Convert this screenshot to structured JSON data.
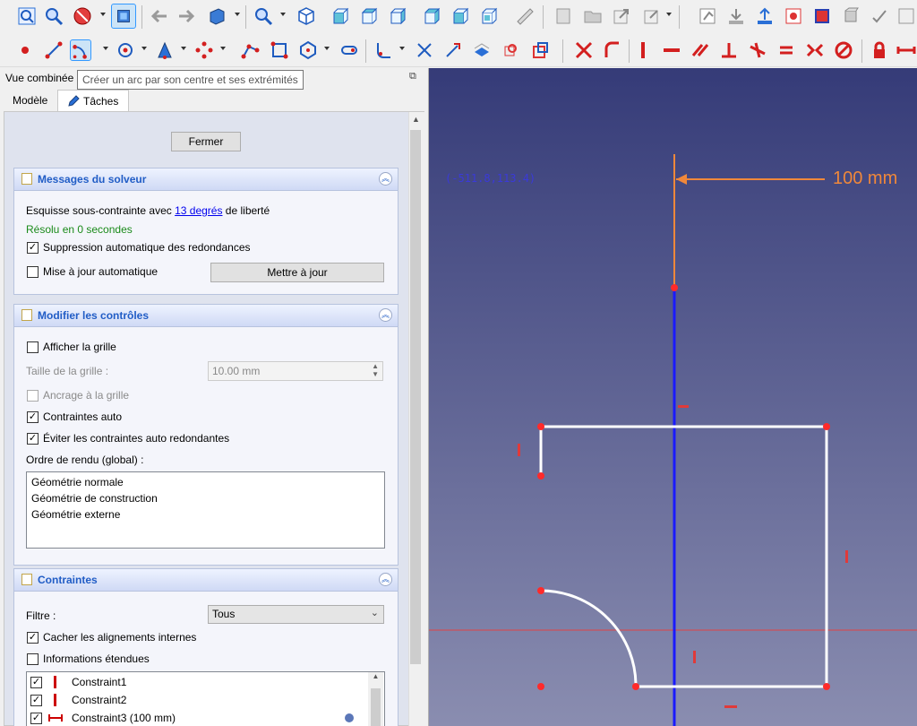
{
  "panel": {
    "title": "Vue combinée",
    "float_icon": "⧉",
    "tabs": [
      {
        "label": "Modèle",
        "icon": ""
      },
      {
        "label": "Tâches",
        "icon": "pencil-icon"
      }
    ]
  },
  "tooltip": "Créer un arc par son centre et ses extrémités",
  "close_button": "Fermer",
  "solver": {
    "title": "Messages du solveur",
    "undercon_prefix": "Esquisse sous-contrainte avec ",
    "dof_link": "13 degrés",
    "undercon_suffix": " de liberté",
    "solved": "Résolu en 0 secondes",
    "auto_remove_label": "Suppression automatique des redondances",
    "auto_remove_checked": true,
    "auto_update_label": "Mise à jour automatique",
    "auto_update_checked": false,
    "update_button": "Mettre à jour"
  },
  "controls": {
    "title": "Modifier les contrôles",
    "show_grid_label": "Afficher la grille",
    "show_grid_checked": false,
    "grid_size_label": "Taille de la grille :",
    "grid_size_value": "10.00 mm",
    "grid_snap_label": "Ancrage à la grille",
    "grid_snap_checked": false,
    "auto_constraints_label": "Contraintes auto",
    "auto_constraints_checked": true,
    "avoid_redundant_label": "Éviter les contraintes auto redondantes",
    "avoid_redundant_checked": true,
    "render_order_label": "Ordre de rendu (global) :",
    "render_order": [
      "Géométrie normale",
      "Géométrie de construction",
      "Géométrie externe"
    ]
  },
  "constraints": {
    "title": "Contraintes",
    "filter_label": "Filtre :",
    "filter_value": "Tous",
    "hide_internal_label": "Cacher les alignements internes",
    "hide_internal_checked": true,
    "extended_info_label": "Informations étendues",
    "extended_info_checked": false,
    "items": [
      {
        "label": "Constraint1",
        "checked": true,
        "icon": "vertical-constraint-icon"
      },
      {
        "label": "Constraint2",
        "checked": true,
        "icon": "vertical-constraint-icon"
      },
      {
        "label": "Constraint3 (100 mm)",
        "checked": true,
        "icon": "horizontal-distance-icon"
      }
    ]
  },
  "view": {
    "coordinates": "(-511.8,113.4)",
    "dimension_label": "100 mm"
  },
  "colors": {
    "accent": "#215dc6",
    "constraint_red": "#cc0000",
    "sketch_white": "#ffffff",
    "axis_blue": "#1a1aff",
    "dimension_orange": "#f0883a"
  }
}
